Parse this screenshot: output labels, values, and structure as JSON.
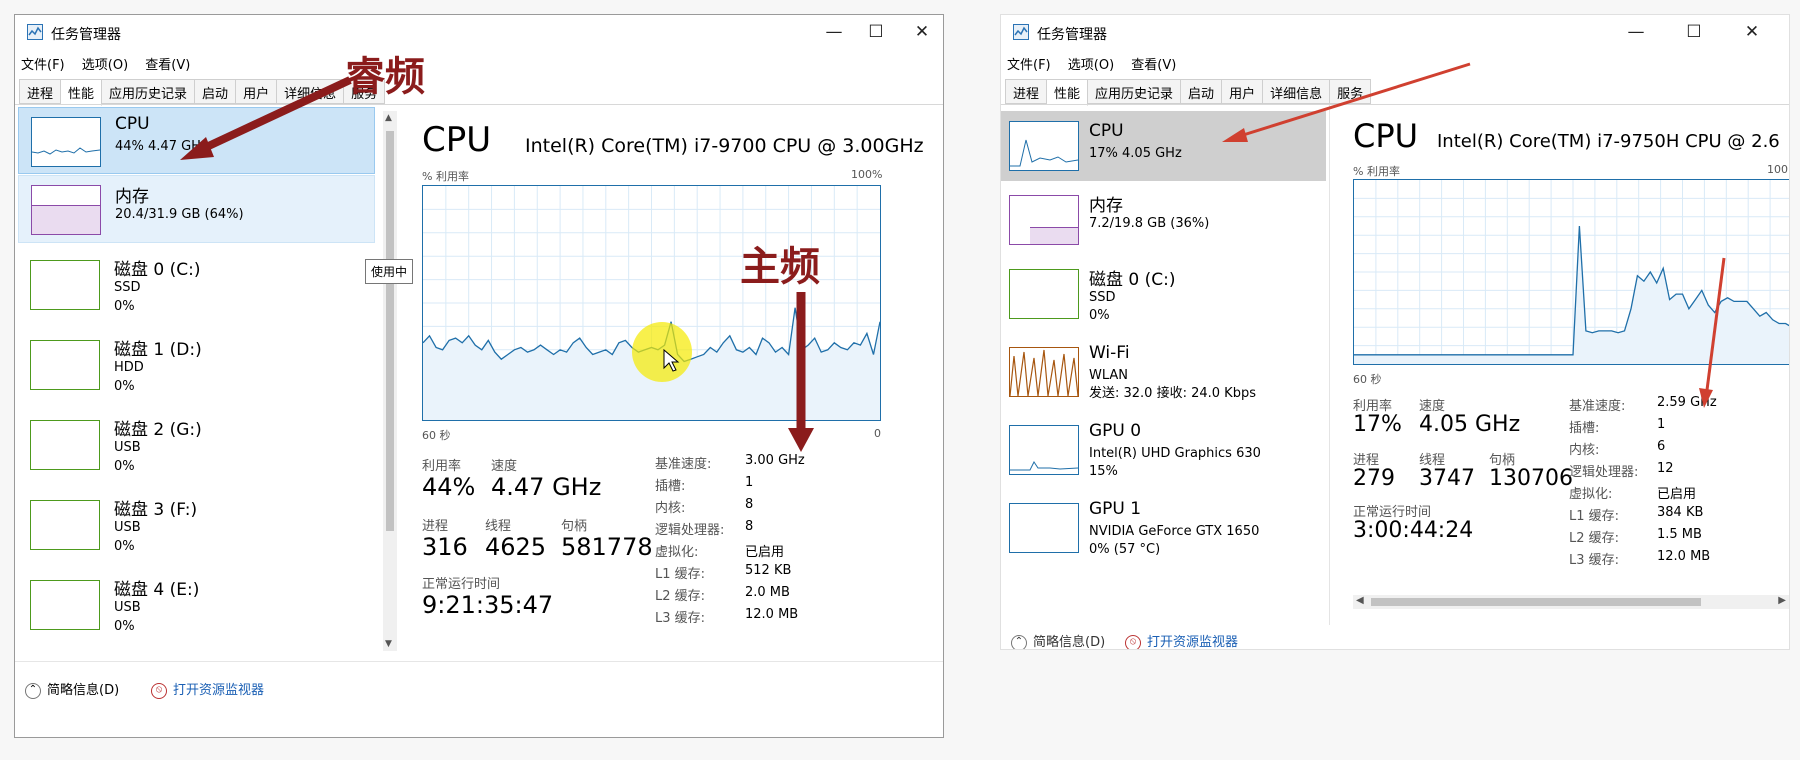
{
  "left": {
    "title": "任务管理器",
    "window_buttons": [
      "—",
      "☐",
      "✕"
    ],
    "menu": [
      "文件(F)",
      "选项(O)",
      "查看(V)"
    ],
    "tabs": [
      "进程",
      "性能",
      "应用历史记录",
      "启动",
      "用户",
      "详细信息",
      "服务"
    ],
    "sidebar": [
      {
        "name": "CPU",
        "sub1": "44% 4.47 GHz",
        "color": "#1f6fa9"
      },
      {
        "name": "内存",
        "sub1": "20.4/31.9 GB (64%)",
        "color": "#8b4aa8"
      },
      {
        "name": "磁盘 0 (C:)",
        "sub1": "SSD",
        "sub2": "0%",
        "color": "#4d9a1d"
      },
      {
        "name": "磁盘 1 (D:)",
        "sub1": "HDD",
        "sub2": "0%",
        "color": "#4d9a1d"
      },
      {
        "name": "磁盘 2 (G:)",
        "sub1": "USB",
        "sub2": "0%",
        "color": "#4d9a1d"
      },
      {
        "name": "磁盘 3 (F:)",
        "sub1": "USB",
        "sub2": "0%",
        "color": "#4d9a1d"
      },
      {
        "name": "磁盘 4 (E:)",
        "sub1": "USB",
        "sub2": "0%",
        "color": "#4d9a1d"
      }
    ],
    "tooltip": "使用中",
    "detail": {
      "heading": "CPU",
      "model": "Intel(R) Core(TM) i7-9700 CPU @ 3.00GHz",
      "util_label": "% 利用率",
      "pct_max": "100%",
      "time_left": "60 秒",
      "time_right": "0",
      "usage_series": [
        33,
        36,
        31,
        30,
        34,
        35,
        33,
        36,
        32,
        30,
        34,
        29,
        26,
        28,
        30,
        31,
        29,
        30,
        32,
        30,
        28,
        30,
        29,
        33,
        35,
        31,
        28,
        29,
        30,
        28,
        33,
        34,
        31,
        29,
        30,
        31,
        30,
        32,
        42,
        28,
        25,
        26,
        27,
        28,
        31,
        29,
        33,
        36,
        30,
        29,
        31,
        28,
        35,
        33,
        29,
        31,
        28,
        48,
        30,
        32,
        35,
        29,
        30,
        33,
        31,
        30,
        33,
        32,
        37,
        28,
        42
      ],
      "stats": [
        {
          "label": "利用率",
          "value": "44%"
        },
        {
          "label": "速度",
          "value": "4.47 GHz"
        },
        {
          "label": "进程",
          "value": "316"
        },
        {
          "label": "线程",
          "value": "4625"
        },
        {
          "label": "句柄",
          "value": "581778"
        }
      ],
      "uptime_label": "正常运行时间",
      "uptime": "9:21:35:47",
      "specs": [
        {
          "k": "基准速度:",
          "v": "3.00 GHz"
        },
        {
          "k": "插槽:",
          "v": "1"
        },
        {
          "k": "内核:",
          "v": "8"
        },
        {
          "k": "逻辑处理器:",
          "v": "8"
        },
        {
          "k": "虚拟化:",
          "v": "已启用"
        },
        {
          "k": "L1 缓存:",
          "v": "512 KB"
        },
        {
          "k": "L2 缓存:",
          "v": "2.0 MB"
        },
        {
          "k": "L3 缓存:",
          "v": "12.0 MB"
        }
      ]
    },
    "footer": {
      "brief": "简略信息(D)",
      "monitor": "打开资源监视器"
    }
  },
  "annotations": {
    "ruipin": "睿频",
    "zhupin": "主频",
    "arrow_color": "#8b1c1c"
  },
  "right": {
    "title": "任务管理器",
    "window_buttons": [
      "—",
      "☐",
      "✕"
    ],
    "menu": [
      "文件(F)",
      "选项(O)",
      "查看(V)"
    ],
    "tabs": [
      "进程",
      "性能",
      "应用历史记录",
      "启动",
      "用户",
      "详细信息",
      "服务"
    ],
    "sidebar": [
      {
        "name": "CPU",
        "sub1": "17% 4.05 GHz",
        "color": "#1f6fa9"
      },
      {
        "name": "内存",
        "sub1": "7.2/19.8 GB (36%)",
        "color": "#8b4aa8"
      },
      {
        "name": "磁盘 0 (C:)",
        "sub1": "SSD",
        "sub2": "0%",
        "color": "#4d9a1d"
      },
      {
        "name": "Wi-Fi",
        "sub1": "WLAN",
        "sub2": "发送: 32.0  接收: 24.0 Kbps",
        "color": "#a7560f"
      },
      {
        "name": "GPU 0",
        "sub1": "Intel(R) UHD Graphics 630",
        "sub2": "15%",
        "color": "#1f6fa9"
      },
      {
        "name": "GPU 1",
        "sub1": "NVIDIA GeForce GTX 1650",
        "sub2": "0% (57 °C)",
        "color": "#1f6fa9"
      }
    ],
    "detail": {
      "heading": "CPU",
      "model": "Intel(R) Core(TM) i7-9750H CPU @ 2.6",
      "util_label": "% 利用率",
      "pct_max": "100",
      "time_left": "60 秒",
      "usage_series": [
        5,
        5,
        5,
        5,
        5,
        5,
        5,
        5,
        5,
        5,
        5,
        5,
        5,
        5,
        5,
        5,
        5,
        5,
        5,
        5,
        5,
        5,
        5,
        5,
        5,
        5,
        5,
        5,
        5,
        5,
        5,
        5,
        5,
        5,
        5,
        75,
        18,
        17,
        18,
        18,
        18,
        17,
        18,
        30,
        48,
        45,
        50,
        44,
        52,
        35,
        38,
        38,
        30,
        35,
        40,
        32,
        28,
        34,
        36,
        34,
        34,
        34,
        30,
        26,
        28,
        24,
        22,
        22,
        20
      ],
      "stats": [
        {
          "label": "利用率",
          "value": "17%"
        },
        {
          "label": "速度",
          "value": "4.05 GHz"
        },
        {
          "label": "进程",
          "value": "279"
        },
        {
          "label": "线程",
          "value": "3747"
        },
        {
          "label": "句柄",
          "value": "130706"
        }
      ],
      "uptime_label": "正常运行时间",
      "uptime": "3:00:44:24",
      "specs": [
        {
          "k": "基准速度:",
          "v": "2.59 GHz"
        },
        {
          "k": "插槽:",
          "v": "1"
        },
        {
          "k": "内核:",
          "v": "6"
        },
        {
          "k": "逻辑处理器:",
          "v": "12"
        },
        {
          "k": "虚拟化:",
          "v": "已启用"
        },
        {
          "k": "L1 缓存:",
          "v": "384 KB"
        },
        {
          "k": "L2 缓存:",
          "v": "1.5 MB"
        },
        {
          "k": "L3 缓存:",
          "v": "12.0 MB"
        }
      ]
    },
    "footer": {
      "brief": "简略信息(D)",
      "monitor": "打开资源监视器"
    }
  }
}
